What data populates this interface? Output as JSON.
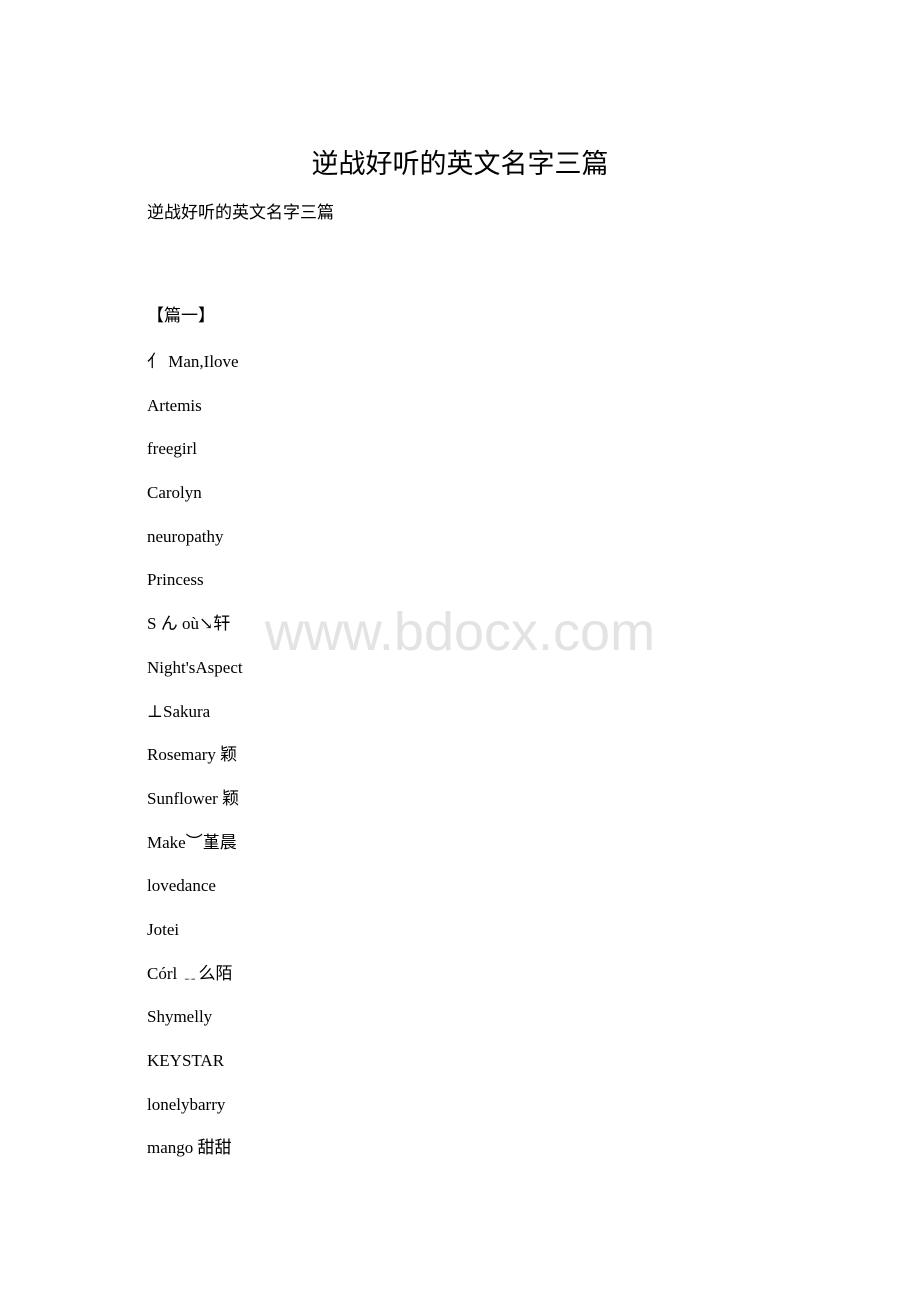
{
  "document": {
    "title": "逆战好听的英文名字三篇",
    "subtitle": "逆战好听的英文名字三篇",
    "sections": [
      {
        "heading": "【篇一】",
        "names": [
          "亻 Man,Ilove",
          "Artemis",
          "freegirl",
          "Carolyn",
          "neuropathy",
          "Princess",
          "S ん où↘轩",
          "Night'sAspect",
          "⊥Sakura",
          "Rosemary 颖",
          "Sunflower 颖",
          "Make︶堇晨",
          "lovedance",
          "Jotei",
          "Córl ﹎么陌",
          "Shymelly",
          "KEYSTAR",
          "lonelybarry",
          "mango 甜甜"
        ]
      }
    ]
  },
  "watermark": "www.bdocx.com"
}
